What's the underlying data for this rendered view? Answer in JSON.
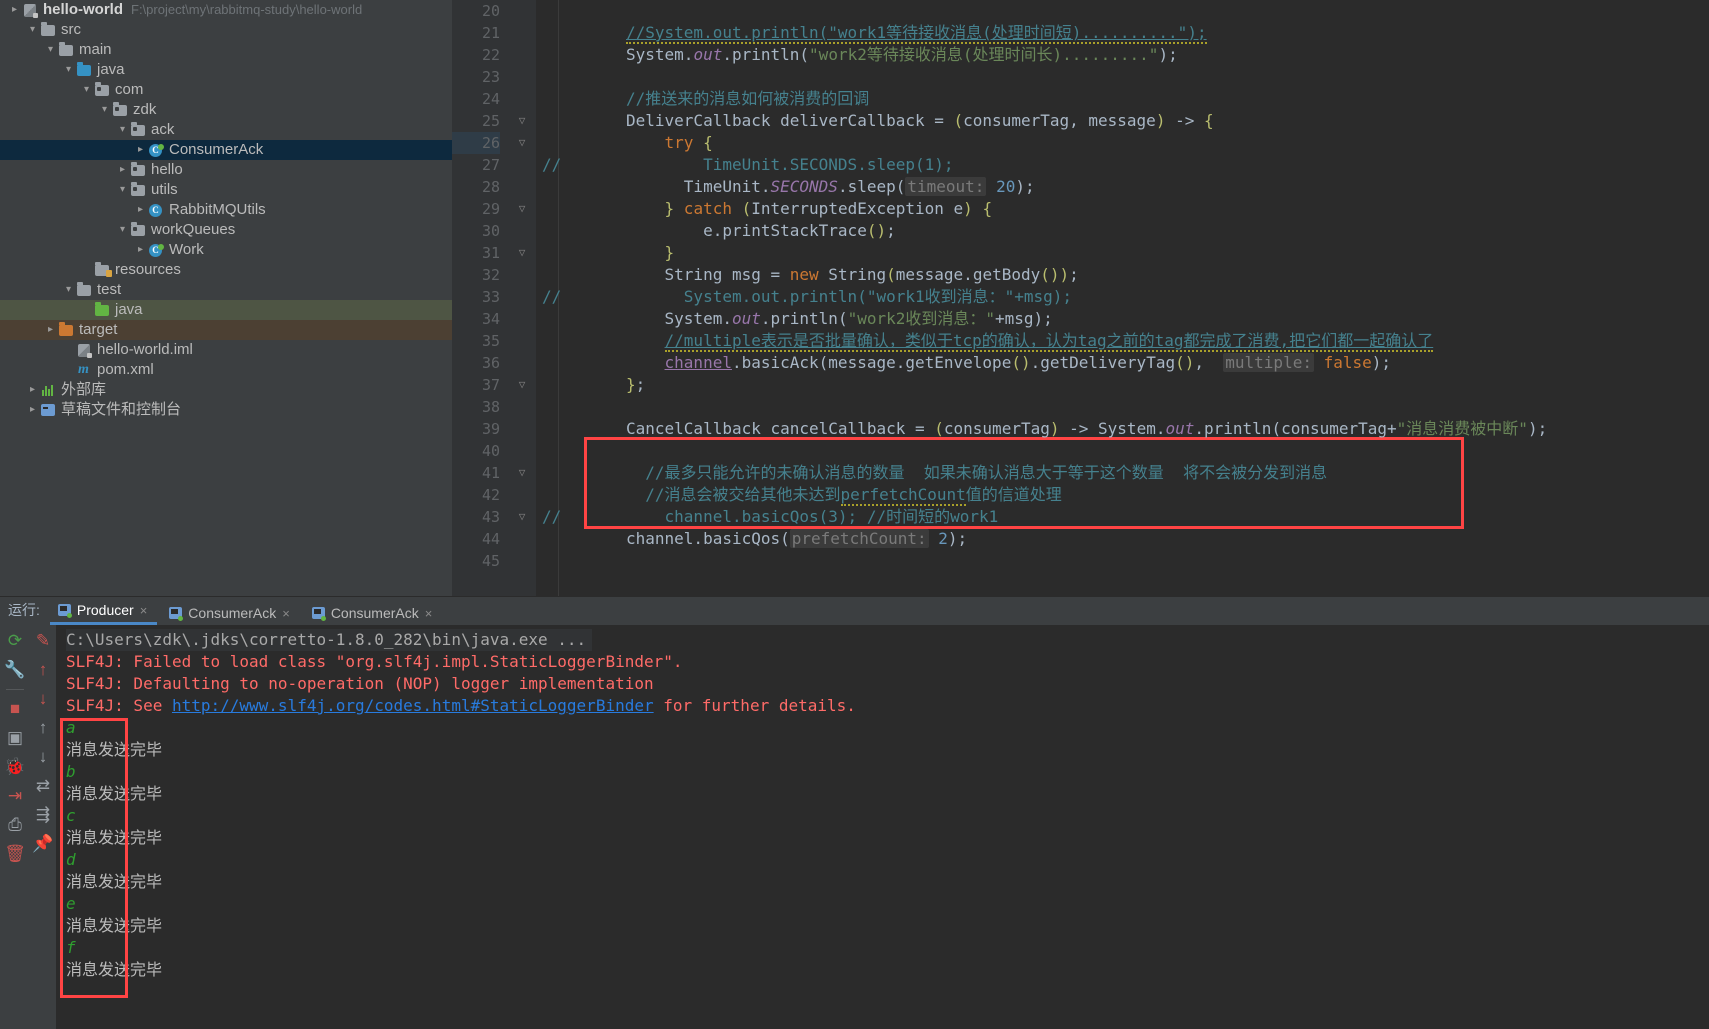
{
  "project_tree": {
    "root": {
      "label": "hello-world",
      "path": "F:\\project\\my\\rabbitmq-study\\hello-world"
    },
    "items": [
      {
        "label": "src",
        "indent": 1,
        "arrow": "v",
        "icon": "folder-gray",
        "state": "none"
      },
      {
        "label": "main",
        "indent": 2,
        "arrow": "v",
        "icon": "folder-gray",
        "state": "none"
      },
      {
        "label": "java",
        "indent": 3,
        "arrow": "v",
        "icon": "folder-blue",
        "state": "none"
      },
      {
        "label": "com",
        "indent": 4,
        "arrow": "v",
        "icon": "folder-pkg",
        "state": "none"
      },
      {
        "label": "zdk",
        "indent": 5,
        "arrow": "v",
        "icon": "folder-pkg",
        "state": "none"
      },
      {
        "label": "ack",
        "indent": 6,
        "arrow": "v",
        "icon": "folder-pkg",
        "state": "none"
      },
      {
        "label": "ConsumerAck",
        "indent": 7,
        "arrow": ">",
        "icon": "class-runnable",
        "state": "selected-blue"
      },
      {
        "label": "hello",
        "indent": 6,
        "arrow": ">",
        "icon": "folder-pkg",
        "state": "none"
      },
      {
        "label": "utils",
        "indent": 6,
        "arrow": "v",
        "icon": "folder-pkg",
        "state": "none"
      },
      {
        "label": "RabbitMQUtils",
        "indent": 7,
        "arrow": ">",
        "icon": "class",
        "state": "none"
      },
      {
        "label": "workQueues",
        "indent": 6,
        "arrow": "v",
        "icon": "folder-pkg",
        "state": "none"
      },
      {
        "label": "Work",
        "indent": 7,
        "arrow": ">",
        "icon": "class-runnable",
        "state": "none"
      },
      {
        "label": "resources",
        "indent": 4,
        "arrow": "",
        "icon": "folder-res",
        "state": "none"
      },
      {
        "label": "test",
        "indent": 3,
        "arrow": "v",
        "icon": "folder-gray",
        "state": "none"
      },
      {
        "label": "java",
        "indent": 4,
        "arrow": "",
        "icon": "folder-green",
        "state": "selected-green"
      },
      {
        "label": "target",
        "indent": 2,
        "arrow": ">",
        "icon": "folder-orange",
        "state": "selected-brown"
      },
      {
        "label": "hello-world.iml",
        "indent": 3,
        "arrow": "",
        "icon": "iml",
        "state": "none"
      },
      {
        "label": "pom.xml",
        "indent": 3,
        "arrow": "",
        "icon": "maven",
        "state": "none"
      },
      {
        "label": "外部库",
        "indent": 1,
        "arrow": ">",
        "icon": "library",
        "state": "none"
      },
      {
        "label": "草稿文件和控制台",
        "indent": 1,
        "arrow": ">",
        "icon": "console",
        "state": "none"
      }
    ]
  },
  "editor": {
    "first_line_number": 20,
    "lines": [
      {
        "n": 20,
        "fold": "",
        "html": ""
      },
      {
        "n": 21,
        "fold": "",
        "html": "<span class=\"cmt-zh wavy und\">//System.out.println(\"work1等待接收消息(处理时间短)..........\");</span>"
      },
      {
        "n": 22,
        "fold": "",
        "html": "<span class=\"br\">System.</span><span class=\"fld\">out</span><span class=\"br\">.println(</span><span class=\"str\">\"work2等待接收消息(处理时间长).........\"</span><span class=\"br\">);</span>"
      },
      {
        "n": 23,
        "fold": "",
        "html": ""
      },
      {
        "n": 24,
        "fold": "",
        "html": "<span class=\"cmt-zh\">//推送来的消息如何被消费的回调</span>"
      },
      {
        "n": 25,
        "fold": "-",
        "html": "<span class=\"br\">DeliverCallback deliverCallback = </span><span class=\"par\">(</span><span class=\"br\">consumerTag, message</span><span class=\"par\">)</span><span class=\"br\"> -&gt; </span><span class=\"par\">{</span>"
      },
      {
        "n": 26,
        "fold": "-",
        "html": "    <span class=\"kw\">try</span><span class=\"par\"> {</span>"
      },
      {
        "n": 27,
        "fold": "",
        "gutter_mark": "//",
        "html": "        <span class=\"cmt-zh\">TimeUnit.SECONDS.sleep(1);</span>"
      },
      {
        "n": 28,
        "fold": "",
        "html": "      <span class=\"br\">TimeUnit.</span><span class=\"fld\">SECONDS</span><span class=\"br\">.sleep(</span><span class=\"hint\">timeout:</span><span class=\"num\"> 20</span><span class=\"br\">);</span>"
      },
      {
        "n": 29,
        "fold": "-",
        "html": "    <span class=\"par\">}</span><span class=\"kw\"> catch </span><span class=\"par\">(</span><span class=\"br\">InterruptedException e</span><span class=\"par\">) {</span>"
      },
      {
        "n": 30,
        "fold": "",
        "html": "        <span class=\"br\">e.printStackTrace</span><span class=\"par\">()</span><span class=\"br\">;</span>"
      },
      {
        "n": 31,
        "fold": "-",
        "html": "    <span class=\"par\">}</span>"
      },
      {
        "n": 32,
        "fold": "",
        "html": "    <span class=\"br\">String msg = </span><span class=\"kw\">new</span><span class=\"br\"> String</span><span class=\"par\">(</span><span class=\"br\">message.getBody</span><span class=\"par\">())</span><span class=\"br\">;</span>"
      },
      {
        "n": 33,
        "fold": "",
        "gutter_mark": "//",
        "html": "      <span class=\"cmt-zh\">System.out.println(\"work1收到消息：\"+msg);</span>"
      },
      {
        "n": 34,
        "fold": "",
        "html": "    <span class=\"br\">System.</span><span class=\"fld\">out</span><span class=\"br\">.println(</span><span class=\"str\">\"work2收到消息：\"</span><span class=\"br\">+msg);</span>"
      },
      {
        "n": 35,
        "fold": "",
        "html": "    <span class=\"cmt-zh wavy und\">//multiple表示是否批量确认，类似于tcp的确认，认为tag之前的tag都完成了消费,把它们都一起确认了</span>"
      },
      {
        "n": 36,
        "fold": "",
        "html": "    <span class=\"stc und\">channel</span><span class=\"br\">.basicAck(message.getEnvelope</span><span class=\"par\">()</span><span class=\"br\">.getDeliveryTag</span><span class=\"par\">()</span><span class=\"br\">,  </span><span class=\"hint\">multiple:</span><span class=\"kw\"> false</span><span class=\"br\">);</span>"
      },
      {
        "n": 37,
        "fold": "-",
        "html": "<span class=\"par\">}</span><span class=\"br\">;</span>"
      },
      {
        "n": 38,
        "fold": "",
        "html": ""
      },
      {
        "n": 39,
        "fold": "",
        "html": "<span class=\"br\">CancelCallback cancelCallback = </span><span class=\"par\">(</span><span class=\"br\">consumerTag</span><span class=\"par\">)</span><span class=\"br\"> -&gt; System.</span><span class=\"fld\">out</span><span class=\"br\">.println(consumerTag+</span><span class=\"str\">\"消息消费被中断\"</span><span class=\"br\">);</span>"
      },
      {
        "n": 40,
        "fold": "",
        "html": ""
      },
      {
        "n": 41,
        "fold": "-",
        "html": "  <span class=\"cmt-zh\">//最多只能允许的未确认消息的数量  如果未确认消息大于等于这个数量  将不会被分发到消息</span>"
      },
      {
        "n": 42,
        "fold": "",
        "html": "  <span class=\"cmt-zh\">//消息会被交给其他未达到</span><span class=\"cmt-zh wavy\">perfetchCount</span><span class=\"cmt-zh\">值的信道处理</span>"
      },
      {
        "n": 43,
        "fold": "-",
        "gutter_mark": "//",
        "html": "    <span class=\"cmt-zh\">channel.basicQos(3); //时间短的work1</span>"
      },
      {
        "n": 44,
        "fold": "",
        "html": "<span class=\"br\">channel.basicQos(</span><span class=\"hint\">prefetchCount:</span><span class=\"num\"> 2</span><span class=\"br\">);</span>"
      },
      {
        "n": 45,
        "fold": "",
        "html": ""
      }
    ],
    "highlight_line": 26,
    "annotation_box_color": "#ff4444"
  },
  "run_panel": {
    "label": "运行:",
    "tabs": [
      {
        "title": "Producer",
        "active": true,
        "close": "×"
      },
      {
        "title": "ConsumerAck",
        "active": false,
        "close": "×"
      },
      {
        "title": "ConsumerAck",
        "active": false,
        "close": "×"
      }
    ],
    "toolbar_left": [
      {
        "name": "rerun-icon",
        "glyph": "⟳",
        "color": "#4a9c4a"
      },
      {
        "name": "settings-icon",
        "glyph": "🔧",
        "color": "#9aa0a6"
      },
      {
        "name": "stop-icon",
        "glyph": "■",
        "color": "#c75450"
      },
      {
        "name": "screenshot-icon",
        "glyph": "▣",
        "color": "#9aa0a6"
      },
      {
        "name": "debug-icon",
        "glyph": "🐞",
        "color": "#62b543"
      },
      {
        "name": "export-icon",
        "glyph": "⇥",
        "color": "#c75450"
      },
      {
        "name": "print-icon",
        "glyph": "⎙",
        "color": "#9aa0a6"
      },
      {
        "name": "trash-icon",
        "glyph": "🗑",
        "color": "#c75450"
      }
    ],
    "toolbar_right": [
      {
        "name": "pencil-icon",
        "glyph": "✎",
        "color": "#c75450"
      },
      {
        "name": "up-red-icon",
        "glyph": "↑",
        "color": "#c75450"
      },
      {
        "name": "down-red-icon",
        "glyph": "↓",
        "color": "#c75450"
      },
      {
        "name": "up-gray-icon",
        "glyph": "↑",
        "color": "#9aa0a6"
      },
      {
        "name": "down-gray-icon",
        "glyph": "↓",
        "color": "#9aa0a6"
      },
      {
        "name": "wrap-icon",
        "glyph": "⇄",
        "color": "#9aa0a6"
      },
      {
        "name": "soft-wrap-icon",
        "glyph": "⇶",
        "color": "#9aa0a6"
      },
      {
        "name": "pin-icon",
        "glyph": "📌",
        "color": "#9aa0a6"
      }
    ],
    "console": [
      {
        "type": "cmd",
        "text": "C:\\Users\\zdk\\.jdks\\corretto-1.8.0_282\\bin\\java.exe ..."
      },
      {
        "type": "err",
        "text": "SLF4J: Failed to load class \"org.slf4j.impl.StaticLoggerBinder\"."
      },
      {
        "type": "err",
        "text": "SLF4J: Defaulting to no-operation (NOP) logger implementation"
      },
      {
        "type": "err-link",
        "prefix": "SLF4J: See ",
        "link": "http://www.slf4j.org/codes.html#StaticLoggerBinder",
        "suffix": " for further details."
      },
      {
        "type": "green",
        "text": "a"
      },
      {
        "type": "out",
        "text": "消息发送完毕"
      },
      {
        "type": "green",
        "text": "b"
      },
      {
        "type": "out",
        "text": "消息发送完毕"
      },
      {
        "type": "green",
        "text": "c"
      },
      {
        "type": "out",
        "text": "消息发送完毕"
      },
      {
        "type": "green",
        "text": "d"
      },
      {
        "type": "out",
        "text": "消息发送完毕"
      },
      {
        "type": "green",
        "text": "e"
      },
      {
        "type": "out",
        "text": "消息发送完毕"
      },
      {
        "type": "green",
        "text": "f"
      },
      {
        "type": "out",
        "text": "消息发送完毕"
      }
    ]
  }
}
